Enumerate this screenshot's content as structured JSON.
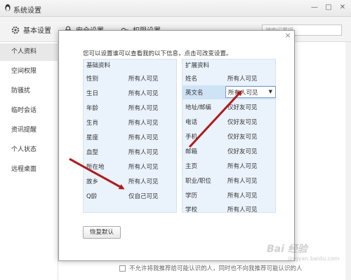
{
  "window": {
    "title": "系统设置",
    "minimize": "—",
    "maximize": "□",
    "close": "✕"
  },
  "tabs": [
    {
      "label": "基本设置",
      "icon": "gear-icon"
    },
    {
      "label": "安全设置",
      "icon": "lock-icon"
    },
    {
      "label": "权限设置",
      "icon": "key-icon"
    }
  ],
  "search": {
    "placeholder": "搜索设置项"
  },
  "sidebar": {
    "items": [
      {
        "label": "个人资料",
        "active": true
      },
      {
        "label": "空间权限"
      },
      {
        "label": "防骚扰"
      },
      {
        "label": "临时会话"
      },
      {
        "label": "资讯提醒"
      },
      {
        "label": "个人状态"
      },
      {
        "label": "远程桌面"
      }
    ]
  },
  "background": {
    "bottom_option": "不允许将我推荐给可能认识的人，同时也不向我推荐可能认识的人"
  },
  "dialog": {
    "close": "×",
    "intro": "您可以设置谁可以查看我的以下信息，点击可改变设置。",
    "basic": {
      "title": "基础资料",
      "rows": [
        {
          "key": "性别",
          "value": "所有人可见"
        },
        {
          "key": "生日",
          "value": "所有人可见"
        },
        {
          "key": "年龄",
          "value": "所有人可见"
        },
        {
          "key": "生肖",
          "value": "所有人可见"
        },
        {
          "key": "星座",
          "value": "所有人可见"
        },
        {
          "key": "血型",
          "value": "所有人可见"
        },
        {
          "key": "所在地",
          "value": "所有人可见"
        },
        {
          "key": "故乡",
          "value": "所有人可见"
        },
        {
          "key": "Q龄",
          "value": "仅自己可见"
        }
      ]
    },
    "extended": {
      "title": "扩展资料",
      "rows": [
        {
          "key": "姓名",
          "value": "所有人可见"
        },
        {
          "key": "英文名",
          "value": "所有人可见"
        },
        {
          "key": "地址/邮编",
          "value": "仅好友可见"
        },
        {
          "key": "电话",
          "value": "仅好友可见"
        },
        {
          "key": "手机",
          "value": "仅好友可见"
        },
        {
          "key": "邮箱",
          "value": "仅好友可见"
        },
        {
          "key": "主页",
          "value": "所有人可见"
        },
        {
          "key": "职业/职位",
          "value": "所有人可见"
        },
        {
          "key": "学历",
          "value": "所有人可见"
        },
        {
          "key": "学校",
          "value": "所有人可见"
        }
      ]
    },
    "reset_label": "恢复默认"
  },
  "watermark": {
    "brand": "Bai 经验",
    "url": "jingyan.baidu.com"
  },
  "colors": {
    "arrow": "#b01a1a",
    "highlight": "#cfe3f6",
    "panel": "#eaf2fb"
  }
}
